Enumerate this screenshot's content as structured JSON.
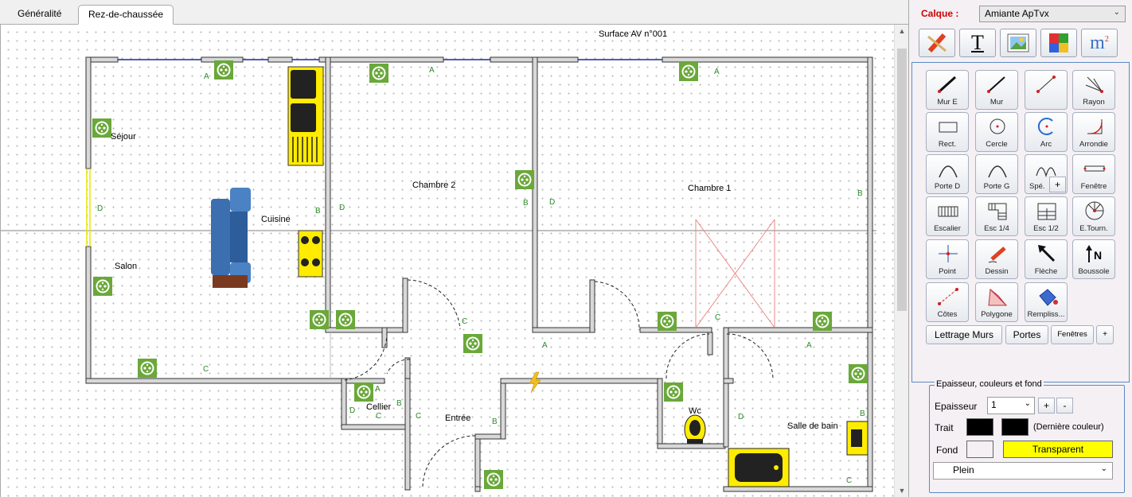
{
  "tabs": [
    {
      "label": "Généralité"
    },
    {
      "label": "Rez-de-chaussée"
    }
  ],
  "plan": {
    "title": "Surface AV n°001",
    "rooms": [
      {
        "label": "Séjour"
      },
      {
        "label": "Cuisine"
      },
      {
        "label": "Salon"
      },
      {
        "label": "Chambre 2"
      },
      {
        "label": "Chambre 1"
      },
      {
        "label": "Cellier"
      },
      {
        "label": "Entrée"
      },
      {
        "label": "Wc"
      },
      {
        "label": "Salle de bain"
      }
    ],
    "wall_letters": [
      "A",
      "B",
      "C",
      "D"
    ]
  },
  "panel": {
    "calque_label": "Calque :",
    "calque_value": "Amiante ApTvx",
    "top_buttons": [
      "pencil-eraser-icon",
      "text-icon",
      "image-icon",
      "puzzle-icon",
      "m2-icon"
    ],
    "m2_text": "m",
    "m2_sup": "2",
    "text_tool_glyph": "T",
    "tools": [
      {
        "label": "Mur E"
      },
      {
        "label": "Mur"
      },
      {
        "label": ""
      },
      {
        "label": "Rayon"
      },
      {
        "label": "Rect."
      },
      {
        "label": "Cercle"
      },
      {
        "label": "Arc"
      },
      {
        "label": "Arrondie"
      },
      {
        "label": "Porte D"
      },
      {
        "label": "Porte G"
      },
      {
        "label": "Spé."
      },
      {
        "label": "Fenêtre"
      },
      {
        "label": "Escalier"
      },
      {
        "label": "Esc 1/4"
      },
      {
        "label": "Esc 1/2"
      },
      {
        "label": "E.Tourn."
      },
      {
        "label": "Point"
      },
      {
        "label": "Dessin"
      },
      {
        "label": "Flèche"
      },
      {
        "label": "Boussole"
      },
      {
        "label": "Côtes"
      },
      {
        "label": "Polygone"
      },
      {
        "label": "Rempliss..."
      }
    ],
    "spe_plus": "+",
    "lettrage": "Lettrage Murs",
    "portes": "Portes",
    "fenetres": "Fenêtres",
    "plus": "+",
    "group_title": "Epaisseur, couleurs et fond",
    "epaisseur_label": "Epaisseur",
    "epaisseur_value": "1",
    "minus": "-",
    "trait_label": "Trait",
    "derniere_couleur": "(Dernière couleur)",
    "fond_label": "Fond",
    "transparent": "Transparent",
    "pattern": "Plein",
    "colors": {
      "trait": "#000000",
      "fond": "#f4f0f4",
      "transparent_bg": "#ffff00",
      "accent_red": "#d00000"
    }
  }
}
